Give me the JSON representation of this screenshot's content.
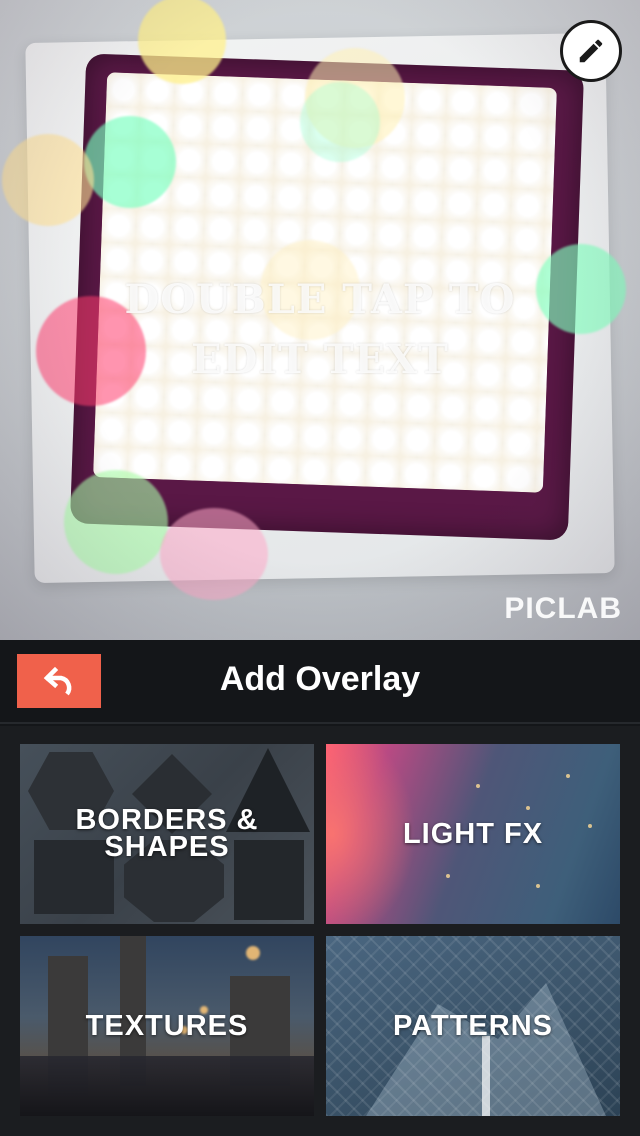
{
  "photo": {
    "overlay_text": "DOUBLE TAP TO EDIT TEXT",
    "brand": "PICLAB",
    "edit_icon": "pencil-icon"
  },
  "toolbar": {
    "title": "Add Overlay",
    "undo_icon": "undo-arrow-icon",
    "undo_color": "#f0614b"
  },
  "overlays": [
    {
      "label_line1": "BORDERS &",
      "label_line2": "SHAPES"
    },
    {
      "label": "LIGHT FX"
    },
    {
      "label": "TEXTURES"
    },
    {
      "label": "PATTERNS"
    }
  ]
}
